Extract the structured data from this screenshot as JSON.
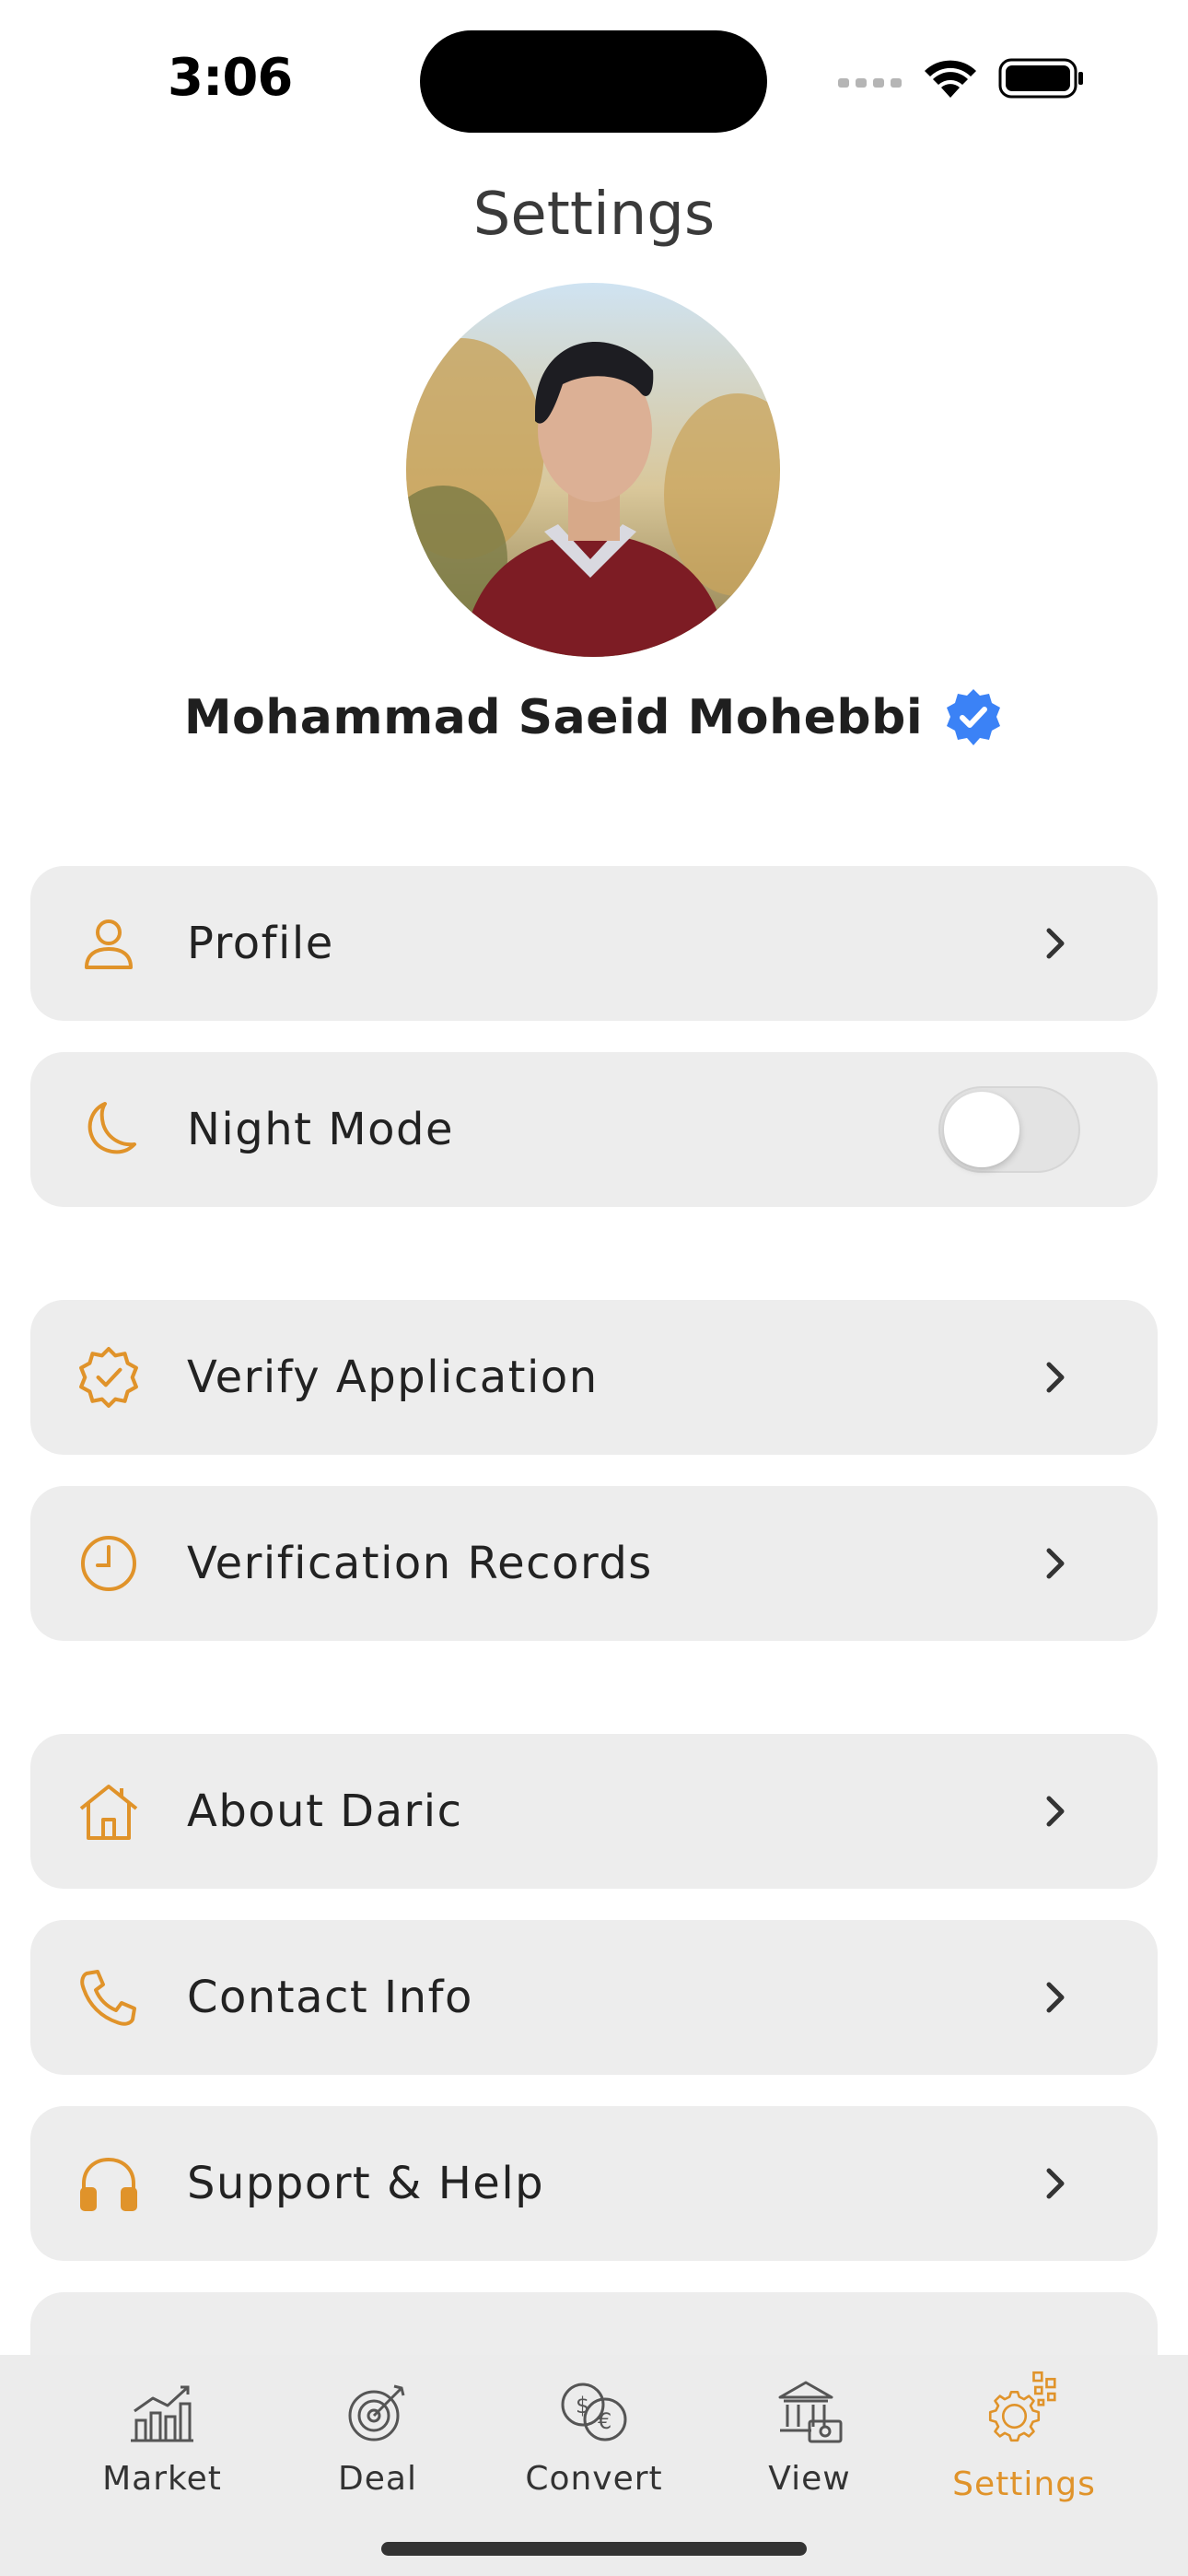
{
  "status_bar": {
    "time": "3:06"
  },
  "header": {
    "title": "Settings"
  },
  "user": {
    "name": "Mohammad Saeid Mohebbi",
    "verified": true
  },
  "colors": {
    "accent": "#e0932a",
    "card_bg": "#ededed",
    "verified_badge": "#3b82f6"
  },
  "settings": {
    "profile": {
      "label": "Profile",
      "icon": "person-icon"
    },
    "night_mode": {
      "label": "Night Mode",
      "icon": "moon-icon",
      "enabled": false
    },
    "verify_application": {
      "label": "Verify Application",
      "icon": "verified-badge-icon"
    },
    "verification_records": {
      "label": "Verification Records",
      "icon": "clock-icon"
    },
    "about": {
      "label": "About Daric",
      "icon": "house-icon"
    },
    "contact": {
      "label": "Contact Info",
      "icon": "phone-icon"
    },
    "support": {
      "label": "Support & Help",
      "icon": "headphones-icon"
    }
  },
  "tabs": [
    {
      "label": "Market",
      "icon": "chart-icon",
      "active": false
    },
    {
      "label": "Deal",
      "icon": "target-icon",
      "active": false
    },
    {
      "label": "Convert",
      "icon": "currency-exchange-icon",
      "active": false
    },
    {
      "label": "View",
      "icon": "bank-icon",
      "active": false
    },
    {
      "label": "Settings",
      "icon": "gear-icon",
      "active": true
    }
  ]
}
